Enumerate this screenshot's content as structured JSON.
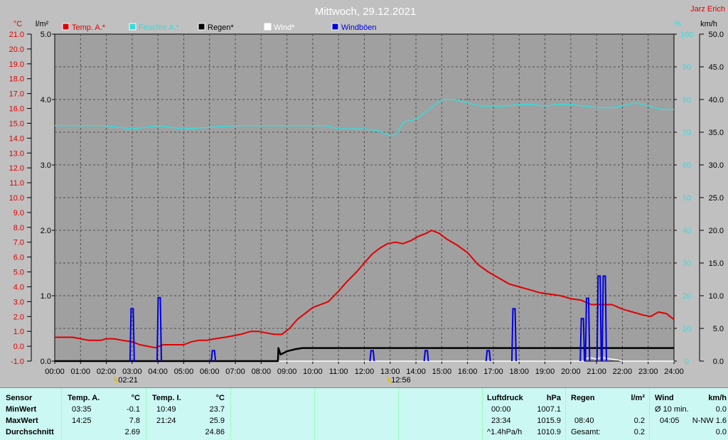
{
  "header": {
    "title": "Mittwoch, 29.12.2021",
    "author": "Jarz Erich"
  },
  "units": {
    "temp": "°C",
    "rain": "l/m²",
    "humidity": "%",
    "wind": "km/h"
  },
  "legend": [
    {
      "label": "Temp. A.*",
      "color": "#e00000"
    },
    {
      "label": "Feuchte A.*",
      "color": "#33dddd"
    },
    {
      "label": "Regen*",
      "color": "#000000"
    },
    {
      "label": "Wind*",
      "color": "#ffffff"
    },
    {
      "label": "Windböen",
      "color": "#0000dd"
    }
  ],
  "markers": [
    {
      "label": "02:21"
    },
    {
      "label": "12:56"
    }
  ],
  "chart_data": {
    "type": "line",
    "x_ticks": [
      "00:00",
      "01:00",
      "02:00",
      "03:00",
      "04:00",
      "05:00",
      "06:00",
      "07:00",
      "08:00",
      "09:00",
      "10:00",
      "11:00",
      "12:00",
      "13:00",
      "14:00",
      "15:00",
      "16:00",
      "17:00",
      "18:00",
      "19:00",
      "20:00",
      "21:00",
      "22:00",
      "23:00",
      "24:00"
    ],
    "xlim": [
      0,
      24
    ],
    "temp_ticks": [
      "21.0",
      "20.0",
      "19.0",
      "18.0",
      "17.0",
      "16.0",
      "15.0",
      "14.0",
      "13.0",
      "12.0",
      "11.0",
      "10.0",
      "9.0",
      "8.0",
      "7.0",
      "6.0",
      "5.0",
      "4.0",
      "3.0",
      "2.0",
      "1.0",
      "0.0",
      "-1.0"
    ],
    "temp_lim": [
      -1,
      21
    ],
    "rain_ticks": [
      "5.0",
      "4.0",
      "3.0",
      "2.0",
      "1.0",
      "0.0"
    ],
    "rain_lim": [
      0,
      5
    ],
    "humidity_ticks": [
      "100",
      "90",
      "80",
      "70",
      "60",
      "50",
      "40",
      "30",
      "20",
      "10",
      "0"
    ],
    "humidity_lim": [
      0,
      100
    ],
    "wind_ticks": [
      "50.0",
      "45.0",
      "40.0",
      "35.0",
      "30.0",
      "25.0",
      "20.0",
      "15.0",
      "10.0",
      "5.0",
      "0.0"
    ],
    "wind_lim": [
      0,
      50
    ],
    "grid": true,
    "series": [
      {
        "name": "Temp. A.*",
        "color": "#e00000",
        "axis": "temp",
        "x": [
          0,
          0.3,
          0.7,
          1.0,
          1.3,
          1.5,
          1.8,
          2.0,
          2.3,
          2.6,
          3.0,
          3.3,
          3.6,
          3.9,
          4.2,
          4.5,
          5.0,
          5.3,
          5.6,
          5.9,
          6.2,
          6.6,
          6.9,
          7.2,
          7.6,
          7.9,
          8.2,
          8.5,
          8.8,
          9.1,
          9.4,
          9.7,
          10.0,
          10.3,
          10.6,
          11.0,
          11.3,
          11.7,
          12.0,
          12.3,
          12.6,
          12.9,
          13.2,
          13.5,
          13.8,
          14.1,
          14.4,
          14.6,
          14.9,
          15.2,
          15.6,
          16.0,
          16.4,
          16.8,
          17.2,
          17.6,
          18.0,
          18.4,
          18.8,
          19.2,
          19.6,
          20.0,
          20.4,
          20.8,
          21.1,
          21.3,
          21.6,
          22.0,
          22.4,
          22.8,
          23.1,
          23.4,
          23.7,
          24.0
        ],
        "y": [
          0.6,
          0.6,
          0.6,
          0.5,
          0.4,
          0.4,
          0.4,
          0.5,
          0.5,
          0.4,
          0.3,
          0.1,
          0.0,
          -0.1,
          0.1,
          0.1,
          0.1,
          0.3,
          0.4,
          0.4,
          0.5,
          0.6,
          0.7,
          0.8,
          1.0,
          1.0,
          0.9,
          0.8,
          0.8,
          1.2,
          1.8,
          2.2,
          2.6,
          2.8,
          3.0,
          3.7,
          4.3,
          5.0,
          5.6,
          6.2,
          6.6,
          6.9,
          7.0,
          6.9,
          7.1,
          7.4,
          7.6,
          7.8,
          7.6,
          7.2,
          6.8,
          6.3,
          5.5,
          5.0,
          4.6,
          4.2,
          4.0,
          3.8,
          3.6,
          3.5,
          3.4,
          3.2,
          3.1,
          2.8,
          2.8,
          2.8,
          2.8,
          2.5,
          2.3,
          2.1,
          2.0,
          2.3,
          2.2,
          1.8
        ]
      },
      {
        "name": "Feuchte A.*",
        "color": "#33dddd",
        "axis": "humidity",
        "x": [
          0,
          1,
          2,
          2.5,
          3,
          3.5,
          4,
          4.5,
          5,
          6,
          7,
          8,
          9,
          10,
          10.5,
          11,
          11.5,
          12,
          12.5,
          13,
          13.2,
          13.5,
          14,
          14.5,
          15,
          15.5,
          16,
          16.5,
          17,
          17.5,
          18,
          18.5,
          19,
          19.5,
          20,
          20.5,
          21,
          21.5,
          22,
          22.5,
          23,
          23.5,
          24
        ],
        "y": [
          72,
          72,
          72,
          71.5,
          71,
          71.5,
          72,
          71.5,
          71,
          71.5,
          72,
          72,
          72,
          72,
          72,
          71,
          71,
          71,
          70.5,
          69,
          69,
          73,
          74,
          77,
          80,
          80,
          79,
          78,
          78,
          78,
          78.5,
          78.5,
          78,
          78.5,
          78.5,
          78,
          77.5,
          77.5,
          78,
          79,
          78,
          77,
          77
        ]
      },
      {
        "name": "Regen*",
        "color": "#000000",
        "axis": "rain",
        "x": [
          0,
          8.65,
          8.67,
          8.75,
          9.0,
          9.3,
          9.6,
          24
        ],
        "y": [
          0,
          0,
          0.2,
          0.1,
          0.15,
          0.18,
          0.2,
          0.2
        ]
      },
      {
        "name": "Wind*",
        "color": "#ffffff",
        "axis": "wind",
        "x": [
          0,
          20.5,
          20.6,
          20.8,
          21.0,
          21.2,
          21.4,
          21.6,
          21.8,
          22.0,
          24
        ],
        "y": [
          0,
          0,
          0.4,
          0.5,
          0.3,
          0.6,
          0.4,
          0.3,
          0.2,
          0,
          0
        ]
      },
      {
        "name": "Windböen",
        "color": "#0000dd",
        "axis": "wind",
        "gusts": [
          {
            "x": 3.0,
            "y": 8
          },
          {
            "x": 4.05,
            "y": 9.7
          },
          {
            "x": 6.15,
            "y": 1.6
          },
          {
            "x": 12.3,
            "y": 1.6
          },
          {
            "x": 14.4,
            "y": 1.6
          },
          {
            "x": 16.8,
            "y": 1.6
          },
          {
            "x": 17.8,
            "y": 8
          },
          {
            "x": 20.45,
            "y": 6.5
          },
          {
            "x": 20.65,
            "y": 9.6
          },
          {
            "x": 21.1,
            "y": 13
          },
          {
            "x": 21.3,
            "y": 13
          }
        ]
      }
    ]
  },
  "footer": {
    "sensor": {
      "header": "Sensor",
      "rows": [
        "MinWert",
        "MaxWert",
        "Durchschnitt"
      ]
    },
    "temp_a": {
      "header": "Temp. A.",
      "unit": "°C",
      "rows": [
        [
          "03:35",
          "-0.1"
        ],
        [
          "14:25",
          "7.8"
        ],
        [
          "",
          "2.69"
        ]
      ]
    },
    "temp_i": {
      "header": "Temp. I.",
      "unit": "°C",
      "rows": [
        [
          "10:49",
          "23.7"
        ],
        [
          "21:24",
          "25.9"
        ],
        [
          "",
          "24.86"
        ]
      ]
    },
    "pressure": {
      "header": "Luftdruck",
      "unit": "hPa",
      "rows": [
        [
          "00:00",
          "1007.1"
        ],
        [
          "23:34",
          "1015.9"
        ],
        [
          "^1.4hPa/h",
          "1010.9"
        ]
      ]
    },
    "rain": {
      "header": "Regen",
      "unit": "l/m²",
      "rows": [
        [
          "",
          ""
        ],
        [
          "08:40",
          "0.2"
        ],
        [
          "Gesamt:",
          "0.2"
        ]
      ]
    },
    "wind": {
      "header": "Wind",
      "unit": "km/h",
      "rows": [
        [
          "Ø 10 min.",
          "0.0"
        ],
        [
          "04:05",
          "N-NW 1.6"
        ],
        [
          "",
          "0.0"
        ]
      ]
    }
  }
}
